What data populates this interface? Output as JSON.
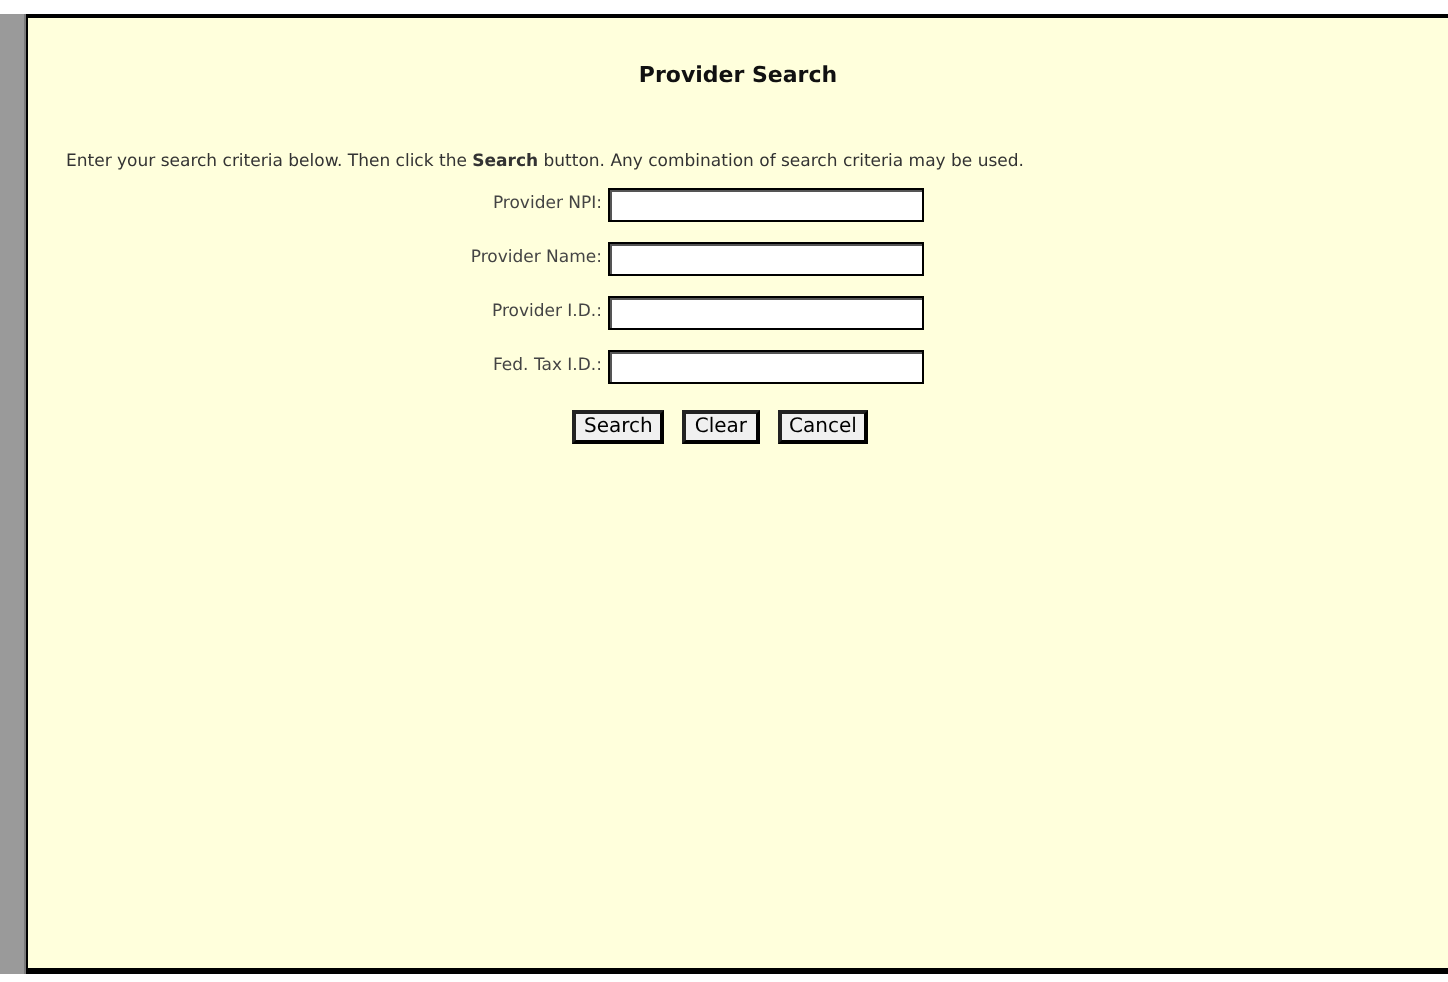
{
  "dialog": {
    "title": "Provider Search",
    "instructions": "Enter your search criteria below. Then click the **Search** button. Any combination of search criteria may be used.",
    "fields": [
      {
        "label": "Provider NPI:"
      },
      {
        "label": "Provider Name:"
      },
      {
        "label": "Provider I.D.:"
      },
      {
        "label": "Fed. Tax I.D.:"
      }
    ],
    "buttons": [
      "Search",
      "Clear",
      "Cancel"
    ]
  }
}
